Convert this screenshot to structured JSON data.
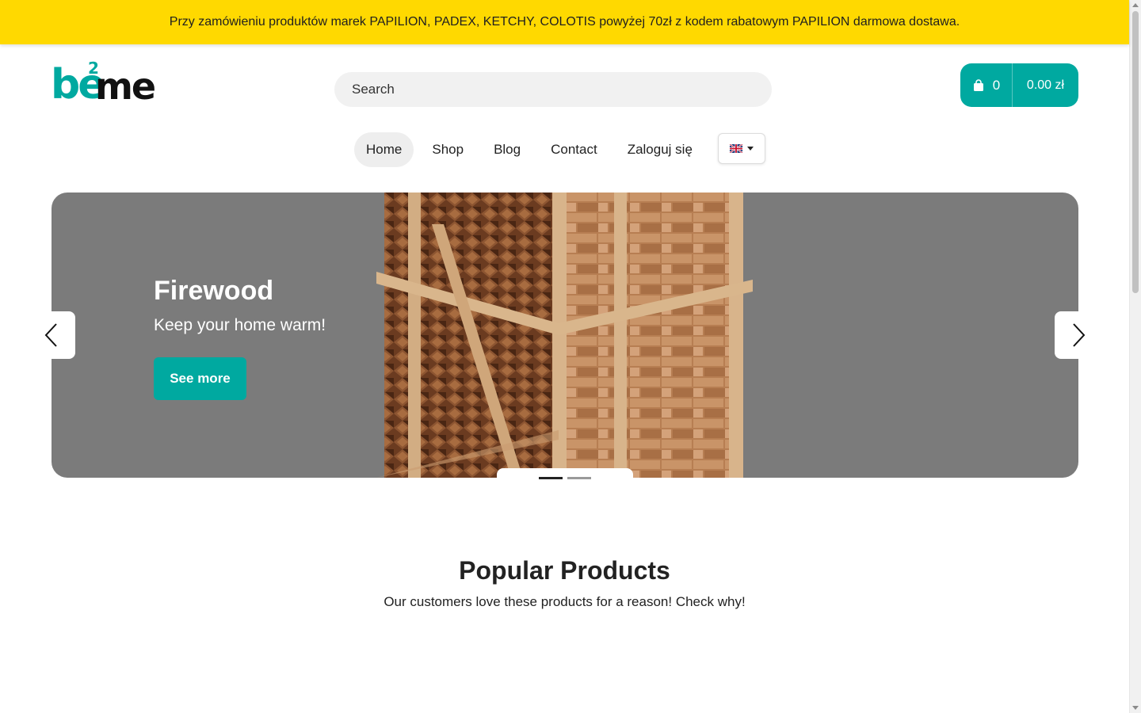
{
  "promo": {
    "text": "Przy zamówieniu produktów marek PAPILION, PADEX, KETCHY, COLOTIS powyżej 70zł z kodem rabatowym PAPILION darmowa dostawa."
  },
  "logo": {
    "text_be": "be",
    "text_sup": "2",
    "text_me": "me"
  },
  "search": {
    "placeholder": "Search"
  },
  "cart": {
    "count": "0",
    "total": "0.00 zł",
    "icon": "shopping-bag-icon"
  },
  "nav": {
    "items": [
      {
        "label": "Home",
        "active": true
      },
      {
        "label": "Shop"
      },
      {
        "label": "Blog"
      },
      {
        "label": "Contact"
      },
      {
        "label": "Zaloguj się"
      }
    ],
    "language_icon": "uk-flag-icon"
  },
  "hero": {
    "title": "Firewood",
    "subtitle": "Keep your home warm!",
    "button_label": "See more",
    "slide_count": 2,
    "active_slide": 1
  },
  "popular": {
    "title": "Popular Products",
    "subtitle": "Our customers love these products for a reason! Check why!"
  },
  "colors": {
    "accent": "#00a9a0",
    "promo_bg": "#ffd900",
    "hero_bg": "#7b7b7b"
  }
}
